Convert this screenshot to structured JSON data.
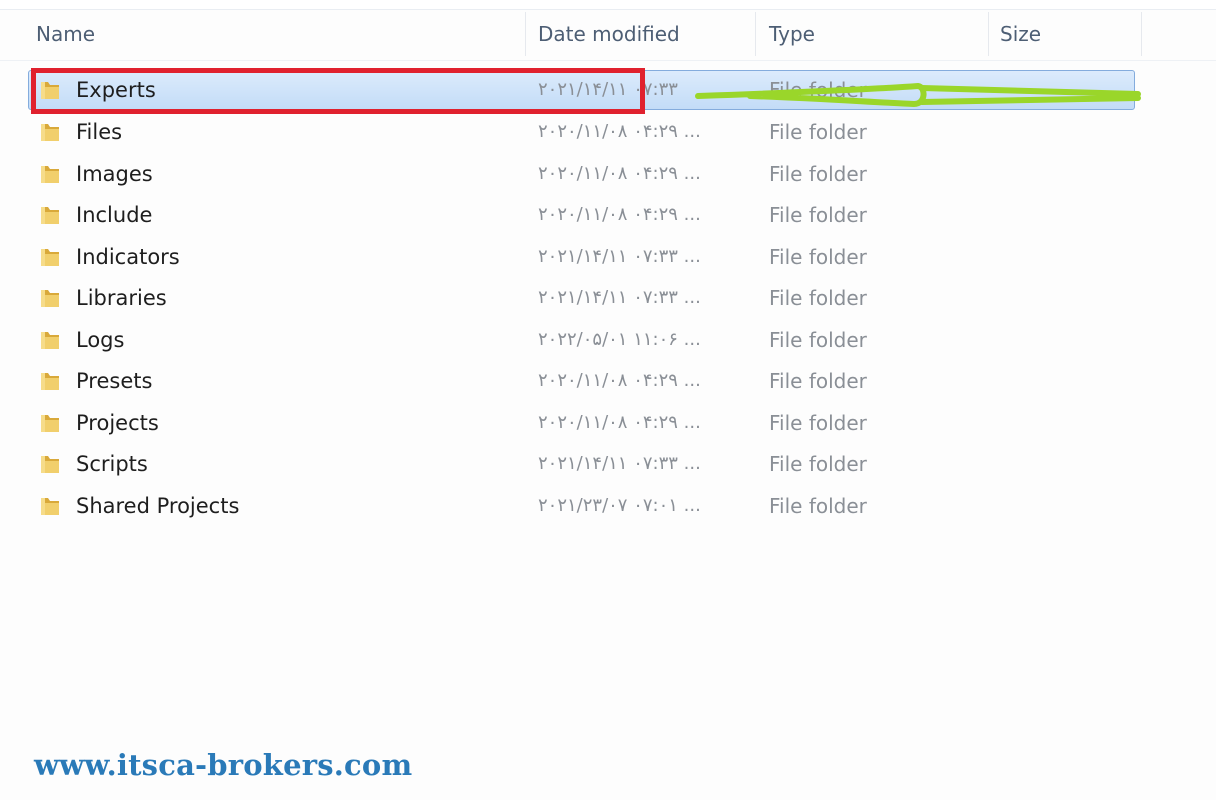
{
  "header": {
    "columns": [
      "Name",
      "Date modified",
      "Type",
      "Size"
    ]
  },
  "files": [
    {
      "name": "Experts",
      "date": "۲۰۲۱/۱۴/۱۱ ۰۷:۳۳",
      "type": "File folder",
      "selected": true
    },
    {
      "name": "Files",
      "date": "۲۰۲۰/۱۱/۰۸ ۰۴:۲۹ ...",
      "type": "File folder"
    },
    {
      "name": "Images",
      "date": "۲۰۲۰/۱۱/۰۸ ۰۴:۲۹ ...",
      "type": "File folder"
    },
    {
      "name": "Include",
      "date": "۲۰۲۰/۱۱/۰۸ ۰۴:۲۹ ...",
      "type": "File folder"
    },
    {
      "name": "Indicators",
      "date": "۲۰۲۱/۱۴/۱۱ ۰۷:۳۳ ...",
      "type": "File folder"
    },
    {
      "name": "Libraries",
      "date": "۲۰۲۱/۱۴/۱۱ ۰۷:۳۳ ...",
      "type": "File folder"
    },
    {
      "name": "Logs",
      "date": "۲۰۲۲/۰۵/۰۱ ۱۱:۰۶ ...",
      "type": "File folder"
    },
    {
      "name": "Presets",
      "date": "۲۰۲۰/۱۱/۰۸ ۰۴:۲۹ ...",
      "type": "File folder"
    },
    {
      "name": "Projects",
      "date": "۲۰۲۰/۱۱/۰۸ ۰۴:۲۹ ...",
      "type": "File folder"
    },
    {
      "name": "Scripts",
      "date": "۲۰۲۱/۱۴/۱۱ ۰۷:۳۳ ...",
      "type": "File folder"
    },
    {
      "name": "Shared Projects",
      "date": "۲۰۲۱/۲۳/۰۷ ۰۷:۰۱ ...",
      "type": "File folder"
    }
  ],
  "watermark": "www.itsca-brokers.com",
  "colors": {
    "selection_fill": "#cfe3fa",
    "selection_border": "#84acdd",
    "highlight_box": "#e0212e",
    "arrow": "#9ad62a",
    "folder": "#e8c25a",
    "watermark": "#2a7ab8"
  },
  "icons": {
    "folder": "folder-icon"
  }
}
